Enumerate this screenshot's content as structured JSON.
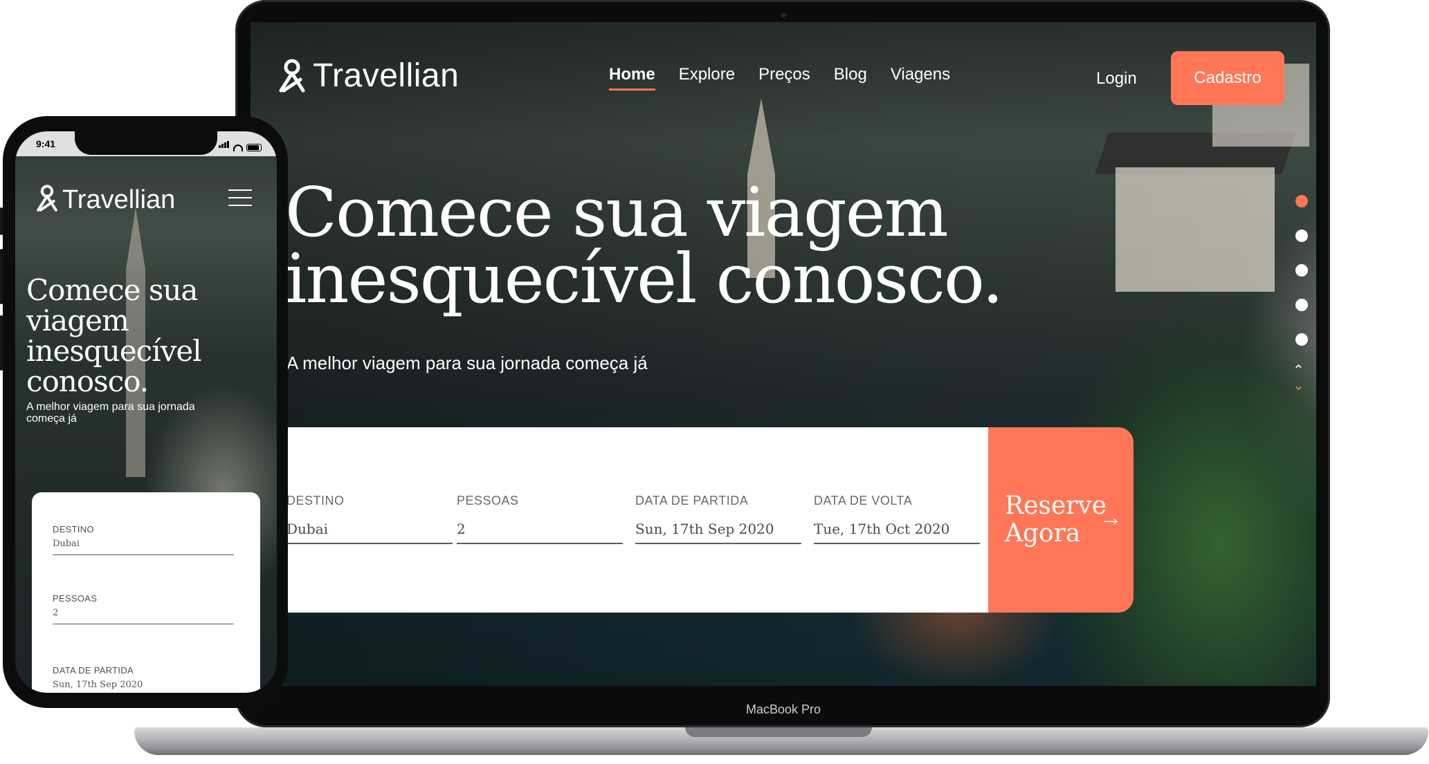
{
  "colors": {
    "accent": "#ff7757",
    "text_light": "#ffffff",
    "field_label": "#6a6a6a"
  },
  "desktop": {
    "brand": {
      "name": "Travellian",
      "icon": "person-pin-logo-icon"
    },
    "nav": {
      "items": [
        "Home",
        "Explore",
        "Preços",
        "Blog",
        "Viagens"
      ],
      "active": "Home"
    },
    "auth": {
      "login": "Login",
      "signup": "Cadastro"
    },
    "hero": {
      "title_line1": "Comece sua viagem",
      "title_line2": "inesquecível conosco.",
      "subtitle": "A melhor viagem para sua jornada começa já"
    },
    "slider": {
      "total": 5,
      "active_index": 0,
      "up_icon": "chevron-up-icon",
      "down_icon": "chevron-down-icon"
    },
    "booking": {
      "fields": [
        {
          "label": "DESTINO",
          "value": "Dubai"
        },
        {
          "label": "PESSOAS",
          "value": "2"
        },
        {
          "label": "DATA DE PARTIDA",
          "value": "Sun, 17th Sep 2020"
        },
        {
          "label": "DATA DE VOLTA",
          "value": "Tue, 17th Oct 2020"
        }
      ],
      "cta": "Reserve Agora",
      "cta_icon": "arrow-right-icon"
    },
    "device_label": "MacBook Pro"
  },
  "mobile": {
    "status_time": "9:41",
    "brand": {
      "name": "Travellian"
    },
    "menu_icon": "hamburger-menu-icon",
    "hero": {
      "title": "Comece sua viagem inesquecível conosco.",
      "subtitle": "A melhor viagem para sua jornada começa já"
    },
    "booking": {
      "fields": [
        {
          "label": "DESTINO",
          "value": "Dubai"
        },
        {
          "label": "PESSOAS",
          "value": "2"
        },
        {
          "label": "DATA DE PARTIDA",
          "value": "Sun, 17th Sep 2020"
        }
      ]
    }
  }
}
